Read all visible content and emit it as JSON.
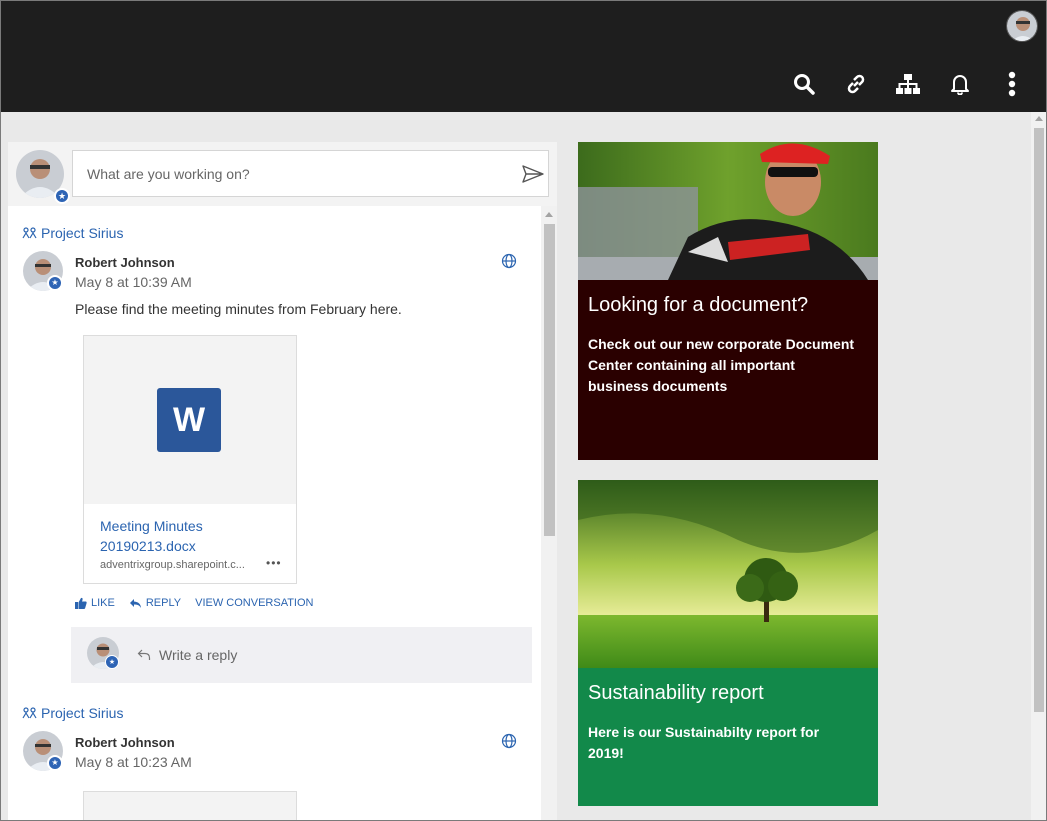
{
  "topbar": {
    "icons": [
      "search-icon",
      "link-icon",
      "sitemap-icon",
      "bell-icon",
      "more-vertical-icon"
    ]
  },
  "composer": {
    "placeholder": "What are you working on?"
  },
  "posts": [
    {
      "group": "Project Sirius",
      "author": "Robert Johnson",
      "date": "May 8 at 10:39 AM",
      "text": "Please find the meeting minutes from February here.",
      "attachment": {
        "icon_letter": "W",
        "title": "Meeting Minutes 20190213.docx",
        "url": "adventrixgroup.sharepoint.c...",
        "more": "•••"
      },
      "actions": {
        "like": "LIKE",
        "reply": "REPLY",
        "view": "VIEW CONVERSATION"
      },
      "reply_placeholder": "Write a reply"
    },
    {
      "group": "Project Sirius",
      "author": "Robert Johnson",
      "date": "May 8 at 10:23 AM"
    }
  ],
  "promos": [
    {
      "title": "Looking for a document?",
      "text": "Check out our new corporate Document Center containing all important business documents",
      "color": "#2a0000"
    },
    {
      "title": "Sustainability report",
      "text": "Here is our Sustainabilty report for 2019!",
      "color": "#12894a"
    }
  ],
  "colors": {
    "topbar": "#1e1e1e",
    "link": "#2b64b0",
    "word": "#2b579a"
  }
}
